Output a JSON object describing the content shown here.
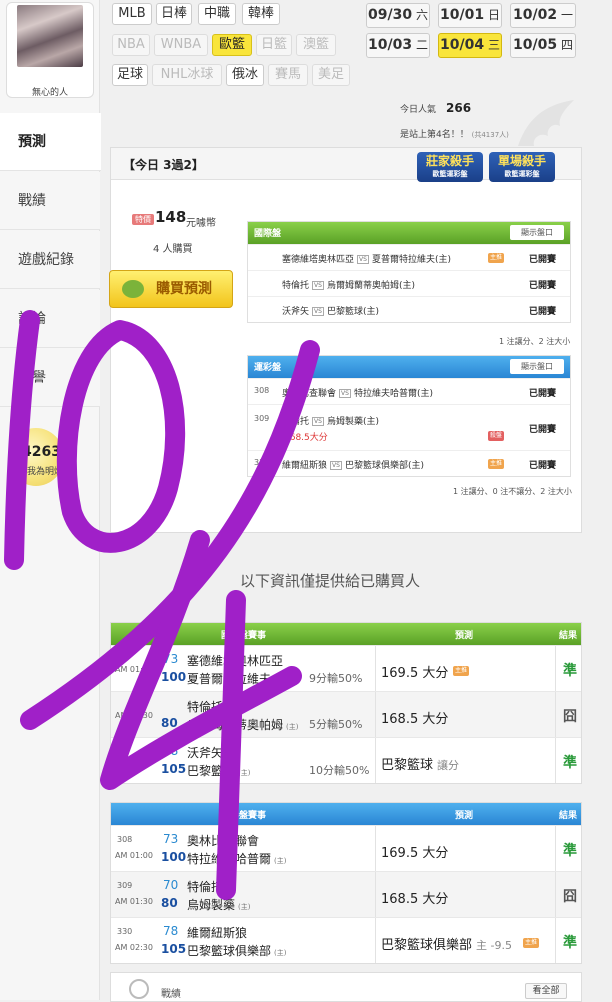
{
  "user": {
    "name": "無心的人"
  },
  "sidebar": {
    "items": [
      {
        "label": "預測"
      },
      {
        "label": "戰績"
      },
      {
        "label": "遊戲紀錄"
      },
      {
        "label": "討論"
      },
      {
        "label": "榮譽"
      }
    ],
    "fans": {
      "count": "4263",
      "unit": "人",
      "text": "加我為明燈"
    }
  },
  "sports_tags": [
    "MLB",
    "日棒",
    "中職",
    "韓棒",
    "NBA",
    "WNBA",
    "歐籃",
    "日籃",
    "澳籃",
    "足球",
    "NHL冰球",
    "俄冰",
    "賽馬",
    "美足"
  ],
  "dates": [
    {
      "md": "09/30",
      "wd": "六"
    },
    {
      "md": "10/01",
      "wd": "日"
    },
    {
      "md": "10/02",
      "wd": "一"
    },
    {
      "md": "10/03",
      "wd": "二"
    },
    {
      "md": "10/04",
      "wd": "三"
    },
    {
      "md": "10/05",
      "wd": "四"
    }
  ],
  "popularity": {
    "label": "今日人氣",
    "value": "266"
  },
  "rank": {
    "text": "是站上第4名！！",
    "small": "(共4137人)"
  },
  "card": {
    "title": "【今日 3過2】",
    "badge1": {
      "main": "莊家殺手",
      "sub": "歐籃運彩盤"
    },
    "badge2": {
      "main": "單場殺手",
      "sub": "歐籃運彩盤"
    },
    "price_tag": "特價",
    "price": "148",
    "price_unit": "元噱幣",
    "buyers": "4 人購買",
    "buy_label": "購買預測"
  },
  "intl_panel": {
    "label": "國際盤",
    "show_label": "顯示盤口",
    "rows": [
      {
        "home": "塞德維塔奧林匹亞",
        "away": "夏普爾特拉維夫(主)",
        "chip": "主推",
        "status": "已開賽"
      },
      {
        "home": "特倫托",
        "away": "烏爾姆蘭蒂奧帕姆(主)",
        "chip": "",
        "status": "已開賽"
      },
      {
        "home": "沃斧矢",
        "away": "巴黎籃球(主)",
        "chip": "",
        "status": "已開賽"
      }
    ],
    "note": "1 注讓分、2 注大小"
  },
  "lottery_panel": {
    "label": "運彩盤",
    "show_label": "顯示盤口",
    "rows": [
      {
        "no": "308",
        "home": "奧林比查聯會",
        "away": "特拉維夫哈普爾(主)",
        "sub": "",
        "chip": "",
        "status": "已開賽"
      },
      {
        "no": "309",
        "home": "特倫托",
        "away": "烏姆製藥(主)",
        "sub": "168.5大分",
        "chip": "殺盤",
        "status": "已開賽"
      },
      {
        "no": "330",
        "home": "維爾紐斯狼",
        "away": "巴黎籃球俱樂部(主)",
        "sub": "",
        "chip": "主推",
        "status": "已開賽"
      }
    ],
    "note": "1 注讓分、0 注不讓分、2 注大小"
  },
  "info_text": "以下資訊僅提供給已購買人",
  "intl_table": {
    "headers": {
      "game": "國際盤賽事",
      "pred": "預測",
      "result": "結果"
    },
    "rows": [
      {
        "time": "AM 01:30",
        "s1": "73",
        "s2": "100",
        "team1": "塞德維塔奧林匹亞",
        "team2": "夏普爾特拉維夫",
        "host": "(主)",
        "handicap": "9分輸50%",
        "pred": "169.5 大分",
        "pred_sub": "",
        "chip": "主推",
        "result": "準"
      },
      {
        "time": "AM 01:30",
        "s1": "",
        "s2": "80",
        "team1": "特倫托",
        "team2": "烏爾姆蘭蒂奧帕姆",
        "host": "(主)",
        "handicap": "5分輸50%",
        "pred": "168.5 大分",
        "pred_sub": "",
        "chip": "",
        "result": "囧"
      },
      {
        "time": "AM 02:30",
        "s1": "78",
        "s2": "105",
        "team1": "沃斧矢",
        "team2": "巴黎籃球",
        "host": "(主)",
        "handicap": "10分輸50%",
        "pred": "巴黎籃球",
        "pred_sub": "讓分",
        "chip": "",
        "result": "準"
      }
    ]
  },
  "lottery_table": {
    "headers": {
      "game": "運彩盤賽事",
      "pred": "預測",
      "result": "結果"
    },
    "rows": [
      {
        "no": "308",
        "time": "AM 01:00",
        "s1": "73",
        "s2": "100",
        "team1": "奧林比查聯會",
        "team2": "特拉維夫哈普爾",
        "host": "(主)",
        "pred": "169.5 大分",
        "pred_sub": "",
        "chip": "",
        "result": "準"
      },
      {
        "no": "309",
        "time": "AM 01:30",
        "s1": "70",
        "s2": "80",
        "team1": "特倫托",
        "team2": "烏姆製藥",
        "host": "(主)",
        "pred": "168.5 大分",
        "pred_sub": "",
        "chip": "",
        "result": "囧"
      },
      {
        "no": "330",
        "time": "AM 02:30",
        "s1": "78",
        "s2": "105",
        "team1": "維爾紐斯狼",
        "team2": "巴黎籃球俱樂部",
        "host": "(主)",
        "pred": "巴黎籃球俱樂部",
        "pred_sub": "主 -9.5",
        "chip": "主推",
        "result": "準"
      }
    ]
  },
  "footer": {
    "label": "戰績",
    "all": "看全部"
  },
  "annotation": {
    "text": "10/4",
    "color": "#a020c8"
  },
  "colors": {
    "highlight": "#f9e53b",
    "green_head": "#6ab02f",
    "blue_head": "#2f8fd8",
    "win": "#2a9a3a"
  }
}
